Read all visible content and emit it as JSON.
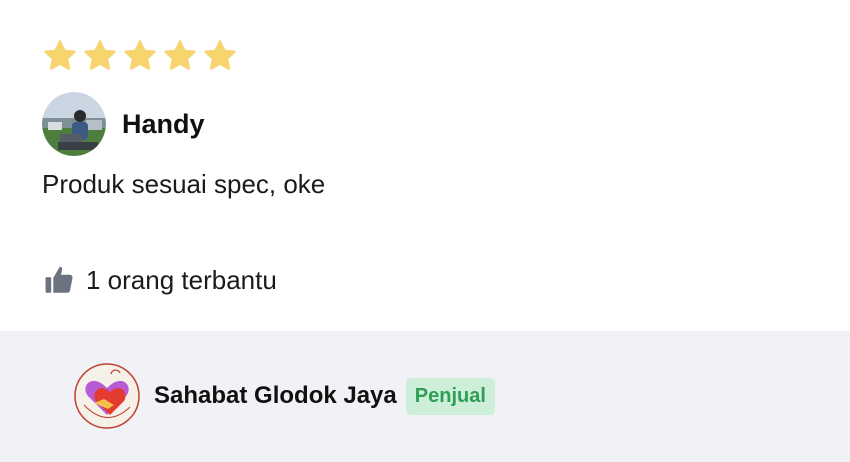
{
  "rating": {
    "value": 5,
    "max": 5,
    "star_color": "#F7D56E",
    "star_icon": "star-icon"
  },
  "reviewer": {
    "name": "Handy",
    "avatar_icon": "user-avatar"
  },
  "review": {
    "text": "Produk sesuai spec, oke"
  },
  "helpful": {
    "icon": "thumbs-up-icon",
    "text": "1 orang terbantu"
  },
  "seller": {
    "name": "Sahabat Glodok Jaya",
    "badge": "Penjual",
    "badge_bg": "#CDEED8",
    "badge_color": "#2F9E55",
    "logo_icon": "seller-logo"
  },
  "colors": {
    "seller_bar_bg": "#F1F2F6",
    "text": "#1B1B1B"
  }
}
